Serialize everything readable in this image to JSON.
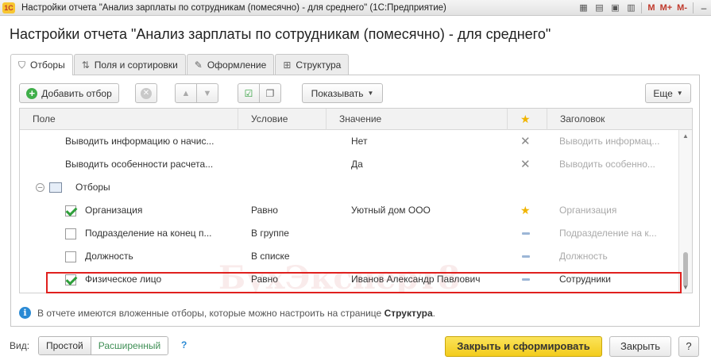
{
  "window": {
    "title": "Настройки отчета \"Анализ зарплаты по сотрудникам (помесячно) - для среднего\"  (1С:Предприятие)",
    "logo": "1С",
    "tools": {
      "m": "M",
      "mplus": "M+",
      "mminus": "M-"
    }
  },
  "page_title": "Настройки отчета \"Анализ зарплаты по сотрудникам (помесячно) - для среднего\"",
  "tabs": [
    {
      "label": "Отборы",
      "icon": "filter-icon",
      "active": true
    },
    {
      "label": "Поля и сортировки",
      "icon": "fields-icon",
      "active": false
    },
    {
      "label": "Оформление",
      "icon": "brush-icon",
      "active": false
    },
    {
      "label": "Структура",
      "icon": "structure-icon",
      "active": false
    }
  ],
  "toolbar": {
    "add_filter": "Добавить отбор",
    "show": "Показывать",
    "more": "Еще"
  },
  "columns": {
    "field": "Поле",
    "condition": "Условие",
    "value": "Значение",
    "title": "Заголовок"
  },
  "rows": [
    {
      "field": "Выводить информацию о начис...",
      "condition": "",
      "value": "Нет",
      "title": "Выводить информац...",
      "mark": "x"
    },
    {
      "field": "Выводить особенности расчета...",
      "condition": "",
      "value": "Да",
      "title": "Выводить особенно...",
      "mark": "x"
    },
    {
      "field": "Отборы",
      "condition": "",
      "value": "",
      "title": "",
      "mark": ""
    },
    {
      "field": "Организация",
      "condition": "Равно",
      "value": "Уютный дом ООО",
      "title": "Организация",
      "mark": "star",
      "checked": true
    },
    {
      "field": "Подразделение на конец п...",
      "condition": "В группе",
      "value": "",
      "title": "Подразделение на к...",
      "mark": "dash",
      "checked": false
    },
    {
      "field": "Должность",
      "condition": "В списке",
      "value": "",
      "title": "Должность",
      "mark": "dash",
      "checked": false
    },
    {
      "field": "Физическое лицо",
      "condition": "Равно",
      "value": "Иванов Александр Павлович",
      "title": "Сотрудники",
      "mark": "dash",
      "checked": true
    }
  ],
  "info": {
    "text": "В отчете имеются вложенные отборы, которые можно настроить на странице",
    "link": "Структура",
    "end": "."
  },
  "watermark": "БухЭксперт8",
  "bottom": {
    "view_label": "Вид:",
    "simple": "Простой",
    "extended": "Расширенный",
    "help": "?",
    "run": "Закрыть и сформировать",
    "close": "Закрыть",
    "question": "?"
  },
  "colors": {
    "accent_yellow": "#f3cc1c",
    "highlight_red": "#e0201e",
    "check_green": "#2e9f3a",
    "info_blue": "#2a8ad4"
  }
}
